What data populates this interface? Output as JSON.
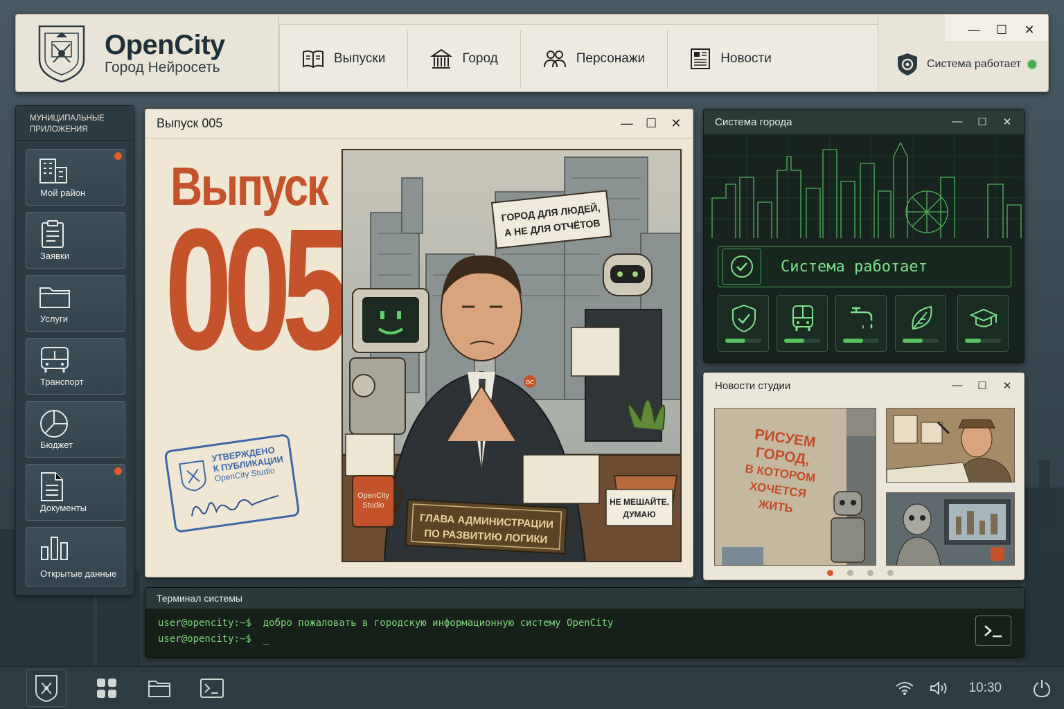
{
  "brand": {
    "title": "OpenCity",
    "subtitle": "Город Нейросеть"
  },
  "nav": [
    {
      "label": "Выпуски",
      "icon": "book-icon"
    },
    {
      "label": "Город",
      "icon": "building-icon"
    },
    {
      "label": "Персонажи",
      "icon": "people-icon"
    },
    {
      "label": "Новости",
      "icon": "newspaper-icon"
    }
  ],
  "header_window": {
    "minimize": "—",
    "maximize": "☐",
    "close": "✕"
  },
  "system_status": {
    "label": "Система работает",
    "color": "#3fae4d"
  },
  "sidebar": {
    "title": "МУНИЦИПАЛЬНЫЕ ПРИЛОЖЕНИЯ",
    "items": [
      {
        "label": "Мой район",
        "icon": "district-icon",
        "badge": true
      },
      {
        "label": "Заявки",
        "icon": "clipboard-icon",
        "badge": false
      },
      {
        "label": "Услуги",
        "icon": "folder-icon",
        "badge": false
      },
      {
        "label": "Транспорт",
        "icon": "bus-icon",
        "badge": false
      },
      {
        "label": "Бюджет",
        "icon": "pie-chart-icon",
        "badge": false
      },
      {
        "label": "Документы",
        "icon": "document-icon",
        "badge": true
      },
      {
        "label": "Открытые данные",
        "icon": "bar-chart-icon",
        "badge": false
      }
    ]
  },
  "issue_window": {
    "title": "Выпуск 005",
    "issue_word": "Выпуск",
    "issue_number": "005",
    "stamp": {
      "line1": "УТВЕРЖДЕНО",
      "line2": "К ПУБЛИКАЦИИ",
      "line3": "OpenCity Studio"
    },
    "comic": {
      "banner_line1": "ГОРОД ДЛЯ ЛЮДЕЙ,",
      "banner_line2": "А НЕ ДЛЯ ОТЧЁТОВ",
      "nameplate_line1": "ГЛАВА АДМИНИСТРАЦИИ",
      "nameplate_line2": "ПО РАЗВИТИЮ ЛОГИКИ",
      "mug_line1": "OpenCity",
      "mug_line2": "Studio",
      "sign_line1": "НЕ МЕШАЙТЕ,",
      "sign_line2": "ДУМАЮ",
      "badge": "OC"
    }
  },
  "system_window": {
    "title": "Система города",
    "banner": "Система работает",
    "services": [
      {
        "icon": "shield-check-icon",
        "level": 0.55
      },
      {
        "icon": "bus-icon",
        "level": 0.55
      },
      {
        "icon": "water-tap-icon",
        "level": 0.55
      },
      {
        "icon": "leaf-icon",
        "level": 0.55
      },
      {
        "icon": "graduation-cap-icon",
        "level": 0.45
      }
    ]
  },
  "news_window": {
    "title": "Новости студии",
    "mural_line1": "РИСУЕМ",
    "mural_line2": "ГОРОД,",
    "mural_line3": "В КОТОРОМ",
    "mural_line4": "ХОЧЕТСЯ",
    "mural_line5": "ЖИТЬ",
    "slides": 4,
    "active_slide": 1
  },
  "terminal": {
    "title": "Терминал системы",
    "line1": "user@opencity:~$  добро пожаловать в городскую информационную систему OpenCity",
    "line2": "user@opencity:~$  _"
  },
  "taskbar": {
    "time": "10:30"
  },
  "colors": {
    "accent": "#c4522a",
    "terminal_green": "#7fd67c",
    "badge": "#e05a2a"
  }
}
